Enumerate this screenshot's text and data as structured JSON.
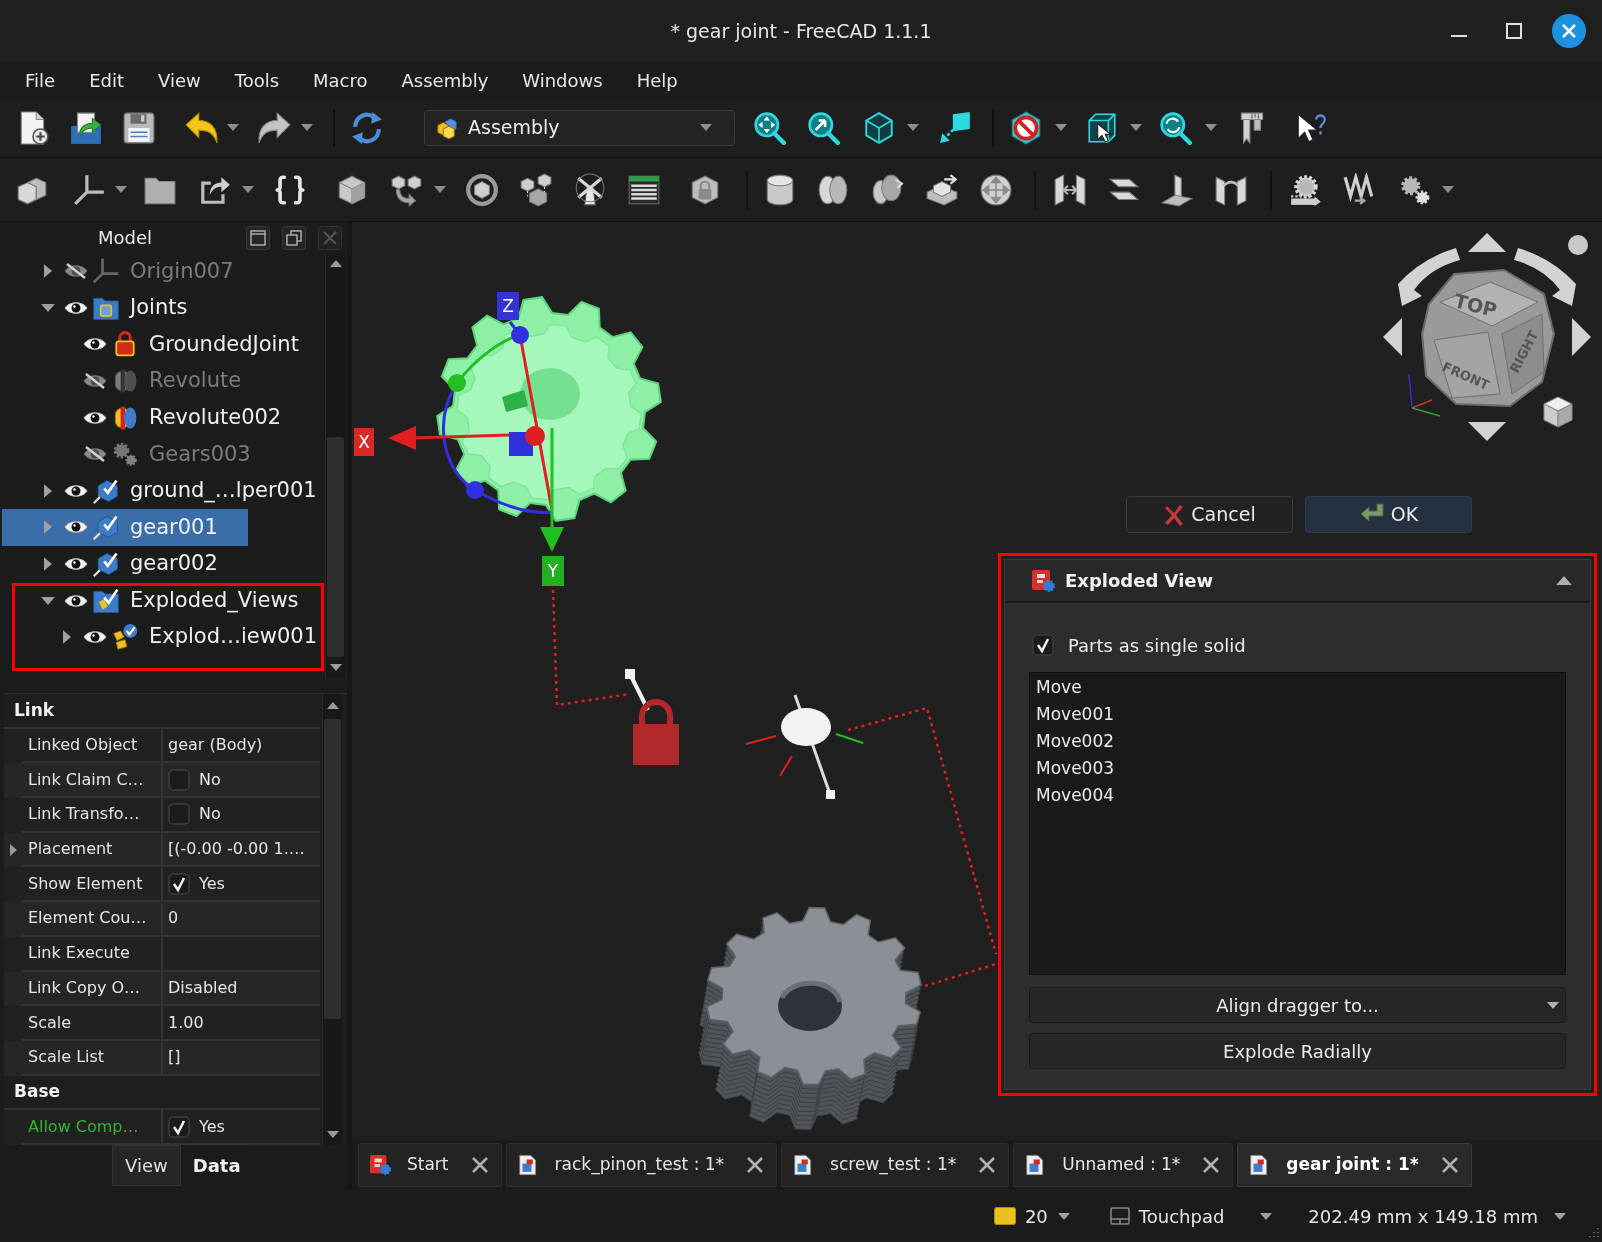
{
  "window": {
    "title": "* gear joint - FreeCAD 1.1.1"
  },
  "menu": [
    "File",
    "Edit",
    "View",
    "Tools",
    "Macro",
    "Assembly",
    "Windows",
    "Help"
  ],
  "toolbar": {
    "workbench": "Assembly"
  },
  "model_panel": {
    "title": "Model",
    "tree": [
      {
        "label": "Origin007",
        "kind": "origin",
        "visible": false,
        "expanded": false,
        "selected": false,
        "highlighted": false
      },
      {
        "label": "Joints",
        "kind": "folder",
        "visible": true,
        "expanded": true,
        "selected": false,
        "highlighted": false,
        "children": [
          {
            "label": "GroundedJoint",
            "kind": "grounded",
            "visible": true,
            "selected": false
          },
          {
            "label": "Revolute",
            "kind": "revolute",
            "visible": false,
            "selected": false
          },
          {
            "label": "Revolute002",
            "kind": "revolute",
            "visible": true,
            "selected": false
          },
          {
            "label": "Gears003",
            "kind": "gears",
            "visible": false,
            "selected": false
          }
        ]
      },
      {
        "label": "ground_…lper001",
        "kind": "link",
        "visible": true,
        "expanded": false,
        "selected": false,
        "highlighted": false
      },
      {
        "label": "gear001",
        "kind": "link",
        "visible": true,
        "expanded": false,
        "selected": true,
        "highlighted": false
      },
      {
        "label": "gear002",
        "kind": "link",
        "visible": true,
        "expanded": false,
        "selected": false,
        "highlighted": false
      },
      {
        "label": "Exploded_Views",
        "kind": "exploded_group",
        "visible": true,
        "expanded": true,
        "selected": false,
        "highlighted": true,
        "children": [
          {
            "label": "Explod…iew001",
            "kind": "exploded",
            "visible": true,
            "expanded": false,
            "selected": false
          }
        ]
      }
    ]
  },
  "property_panel": {
    "groups": [
      {
        "name": "Link",
        "rows": [
          {
            "name": "Linked Object",
            "kind": "text",
            "value": "gear (Body)"
          },
          {
            "name": "Link Claim C…",
            "kind": "checkbox",
            "checked": false,
            "value": "No"
          },
          {
            "name": "Link Transfo…",
            "kind": "checkbox",
            "checked": false,
            "value": "No"
          },
          {
            "name": "Placement",
            "kind": "text",
            "value": "[(-0.00 -0.00 1.…",
            "expanded": false
          },
          {
            "name": "Show Element",
            "kind": "checkbox",
            "checked": true,
            "value": "Yes"
          },
          {
            "name": "Element Cou…",
            "kind": "text",
            "value": "0"
          },
          {
            "name": "Link Execute",
            "kind": "text"
          },
          {
            "name": "Link Copy O…",
            "kind": "text",
            "value": "Disabled"
          },
          {
            "name": "Scale",
            "kind": "text",
            "value": "1.00"
          },
          {
            "name": "Scale List",
            "kind": "text",
            "value": "[]"
          }
        ]
      },
      {
        "name": "Base",
        "rows": [
          {
            "name": "Allow Comp…",
            "kind": "checkbox",
            "checked": true,
            "value": "Yes",
            "color": "#2fb52f"
          }
        ]
      }
    ],
    "tabs": [
      {
        "label": "View",
        "selected": false
      },
      {
        "label": "Data",
        "selected": true
      }
    ]
  },
  "scene": {
    "axis_labels": [
      {
        "label": "X",
        "kind": "x"
      },
      {
        "label": "Y",
        "kind": "y"
      },
      {
        "label": "Z",
        "kind": "z"
      }
    ],
    "nav_cube": [
      {
        "label": "TOP",
        "kind": "top"
      },
      {
        "label": "FRONT",
        "kind": "front"
      },
      {
        "label": "RIGHT",
        "kind": "right"
      }
    ]
  },
  "task_panel": {
    "buttons": [
      {
        "label": "Cancel",
        "kind": "cancel"
      },
      {
        "label": "OK",
        "kind": "ok"
      }
    ],
    "highlighted": true,
    "title": "Exploded View",
    "expanded": true,
    "single_solid": {
      "label": "Parts as single solid",
      "checked": true
    },
    "moves": [
      {
        "label": "Move",
        "selected": false
      },
      {
        "label": "Move001",
        "selected": false
      },
      {
        "label": "Move002",
        "selected": false
      },
      {
        "label": "Move003",
        "selected": false
      },
      {
        "label": "Move004",
        "selected": false
      }
    ],
    "align_dragger": "Align dragger to...",
    "explode_button": "Explode Radially"
  },
  "document_tabs": [
    {
      "label": "Start",
      "kind": "start",
      "selected": false
    },
    {
      "label": "rack_pinon_test : 1*",
      "kind": "document",
      "selected": false
    },
    {
      "label": "screw_test : 1*",
      "kind": "document",
      "selected": false
    },
    {
      "label": "Unnamed : 1*",
      "kind": "document",
      "selected": false
    },
    {
      "label": "gear joint : 1*",
      "kind": "document",
      "selected": true
    }
  ],
  "status_bar": {
    "count": "20",
    "navigation": "Touchpad",
    "dimensions": "202.49 mm x 149.18 mm"
  }
}
